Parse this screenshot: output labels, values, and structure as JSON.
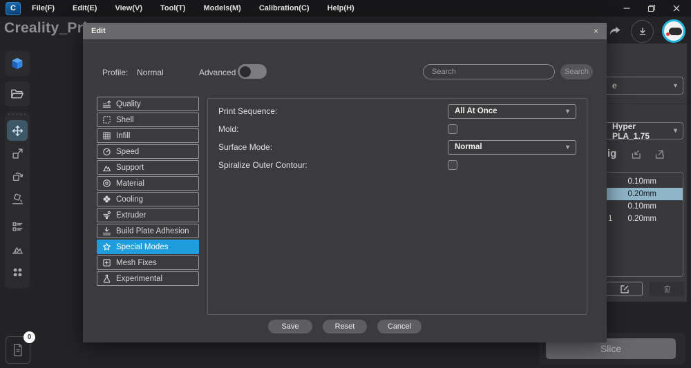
{
  "window": {
    "app_logo": "C",
    "menu": [
      "File(F)",
      "Edit(E)",
      "View(V)",
      "Tool(T)",
      "Models(M)",
      "Calibration(C)",
      "Help(H)"
    ],
    "title": "Creality_Prin",
    "controls": {
      "minimize": "minimize-icon",
      "maximize": "maximize-icon",
      "close": "close-icon"
    },
    "header_icons": [
      "share-icon",
      "download-icon",
      "user-avatar"
    ]
  },
  "left_toolbar": {
    "icons": [
      "prepare-cube-icon",
      "open-folder-icon",
      "move-icon",
      "scale-icon",
      "rotate-icon",
      "lay-flat-icon",
      "object-list-icon",
      "support-paint-icon",
      "apps-icon",
      "file-doc-icon"
    ],
    "selected_tool": "move",
    "file_badge_count": "0"
  },
  "dialog": {
    "title": "Edit",
    "close": "×",
    "profile_label": "Profile:",
    "profile_value": "Normal",
    "advanced_label": "Advanced",
    "advanced_on": false,
    "search_placeholder": "Search",
    "search_button": "Search",
    "categories": [
      {
        "label": "Quality",
        "icon": "quality-icon",
        "selected": false
      },
      {
        "label": "Shell",
        "icon": "shell-icon",
        "selected": false
      },
      {
        "label": "Infill",
        "icon": "infill-icon",
        "selected": false
      },
      {
        "label": "Speed",
        "icon": "speed-icon",
        "selected": false
      },
      {
        "label": "Support",
        "icon": "support-icon",
        "selected": false
      },
      {
        "label": "Material",
        "icon": "material-icon",
        "selected": false
      },
      {
        "label": "Cooling",
        "icon": "cooling-icon",
        "selected": false
      },
      {
        "label": "Extruder",
        "icon": "extruder-icon",
        "selected": false
      },
      {
        "label": "Build Plate Adhesion",
        "icon": "adhesion-icon",
        "selected": false
      },
      {
        "label": "Special Modes",
        "icon": "star-icon",
        "selected": true
      },
      {
        "label": "Mesh Fixes",
        "icon": "mesh-fixes-icon",
        "selected": false
      },
      {
        "label": "Experimental",
        "icon": "flask-icon",
        "selected": false
      }
    ],
    "settings": [
      {
        "label": "Print Sequence:",
        "type": "dropdown",
        "value": "All At Once"
      },
      {
        "label": "Mold:",
        "type": "checkbox",
        "checked": false
      },
      {
        "label": "Surface Mode:",
        "type": "dropdown",
        "value": "Normal"
      },
      {
        "label": "Spiralize Outer Contour:",
        "type": "checkbox",
        "checked": false
      }
    ],
    "buttons": {
      "save": "Save",
      "reset": "Reset",
      "cancel": "Cancel"
    }
  },
  "right_panel": {
    "printer_dropdown_visible_text": "e",
    "material_dropdown_value": "Hyper PLA_1.75",
    "heading_visible_fragment": "ig",
    "io_icons": [
      "import-icon",
      "export-icon"
    ],
    "profiles": [
      {
        "name": "",
        "value": "0.10mm",
        "selected": false
      },
      {
        "name": "",
        "value": "0.20mm",
        "selected": true
      },
      {
        "name": "",
        "value": "0.10mm",
        "selected": false
      },
      {
        "name": "1",
        "value": "0.20mm",
        "selected": false
      }
    ],
    "action_icons": [
      "edit-icon",
      "trash-icon"
    ]
  },
  "bottom": {
    "slice_button": "Slice"
  },
  "colors": {
    "accent_blue": "#1f9ddd",
    "selected_row": "#8fb5c9",
    "dialog_bg": "#3b3b3d",
    "dialog_header": "#69696b",
    "app_bg": "#242427",
    "menubar_bg": "#18181a"
  }
}
